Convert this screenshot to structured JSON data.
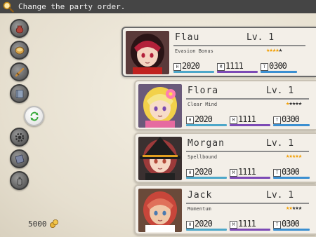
{
  "help_text": "Change the party order.",
  "gold": "5000",
  "sidebar": [
    {
      "icon": "money-bag-icon"
    },
    {
      "icon": "food-bowl-icon"
    },
    {
      "icon": "sword-icon"
    },
    {
      "icon": "book-icon"
    },
    {
      "icon": "swap-icon",
      "active": true
    },
    {
      "icon": "gear-icon"
    },
    {
      "icon": "save-book-icon"
    },
    {
      "icon": "bottle-icon"
    }
  ],
  "members": [
    {
      "name": "Flau",
      "level": "Lv. 1",
      "passive": "Evasion Bonus",
      "stars": "★★★★★",
      "rating": 4,
      "hp_label": "H",
      "hp": "2020",
      "mp_label": "M",
      "mp": "1111",
      "tp_label": "T",
      "tp": "0300",
      "active": true
    },
    {
      "name": "Flora",
      "level": "Lv. 1",
      "passive": "Clear Mind",
      "stars": "★★★★★",
      "rating": 1,
      "hp_label": "H",
      "hp": "2020",
      "mp_label": "M",
      "mp": "1111",
      "tp_label": "T",
      "tp": "0300"
    },
    {
      "name": "Morgan",
      "level": "Lv. 1",
      "passive": "Spellbound",
      "stars": "★★★★★",
      "rating": 5,
      "hp_label": "H",
      "hp": "2020",
      "mp_label": "M",
      "mp": "1111",
      "tp_label": "T",
      "tp": "0300"
    },
    {
      "name": "Jack",
      "level": "Lv. 1",
      "passive": "Momentum",
      "stars": "★★★★★",
      "rating": 2,
      "hp_label": "H",
      "hp": "2020",
      "mp_label": "M",
      "mp": "1111",
      "tp_label": "T",
      "tp": "0300"
    }
  ],
  "colors": {
    "hp_bar": "#4da7c9",
    "mp_bar": "#7c4ab5",
    "tp_bar": "#3b8fd1",
    "star_on": "#f2a007"
  }
}
